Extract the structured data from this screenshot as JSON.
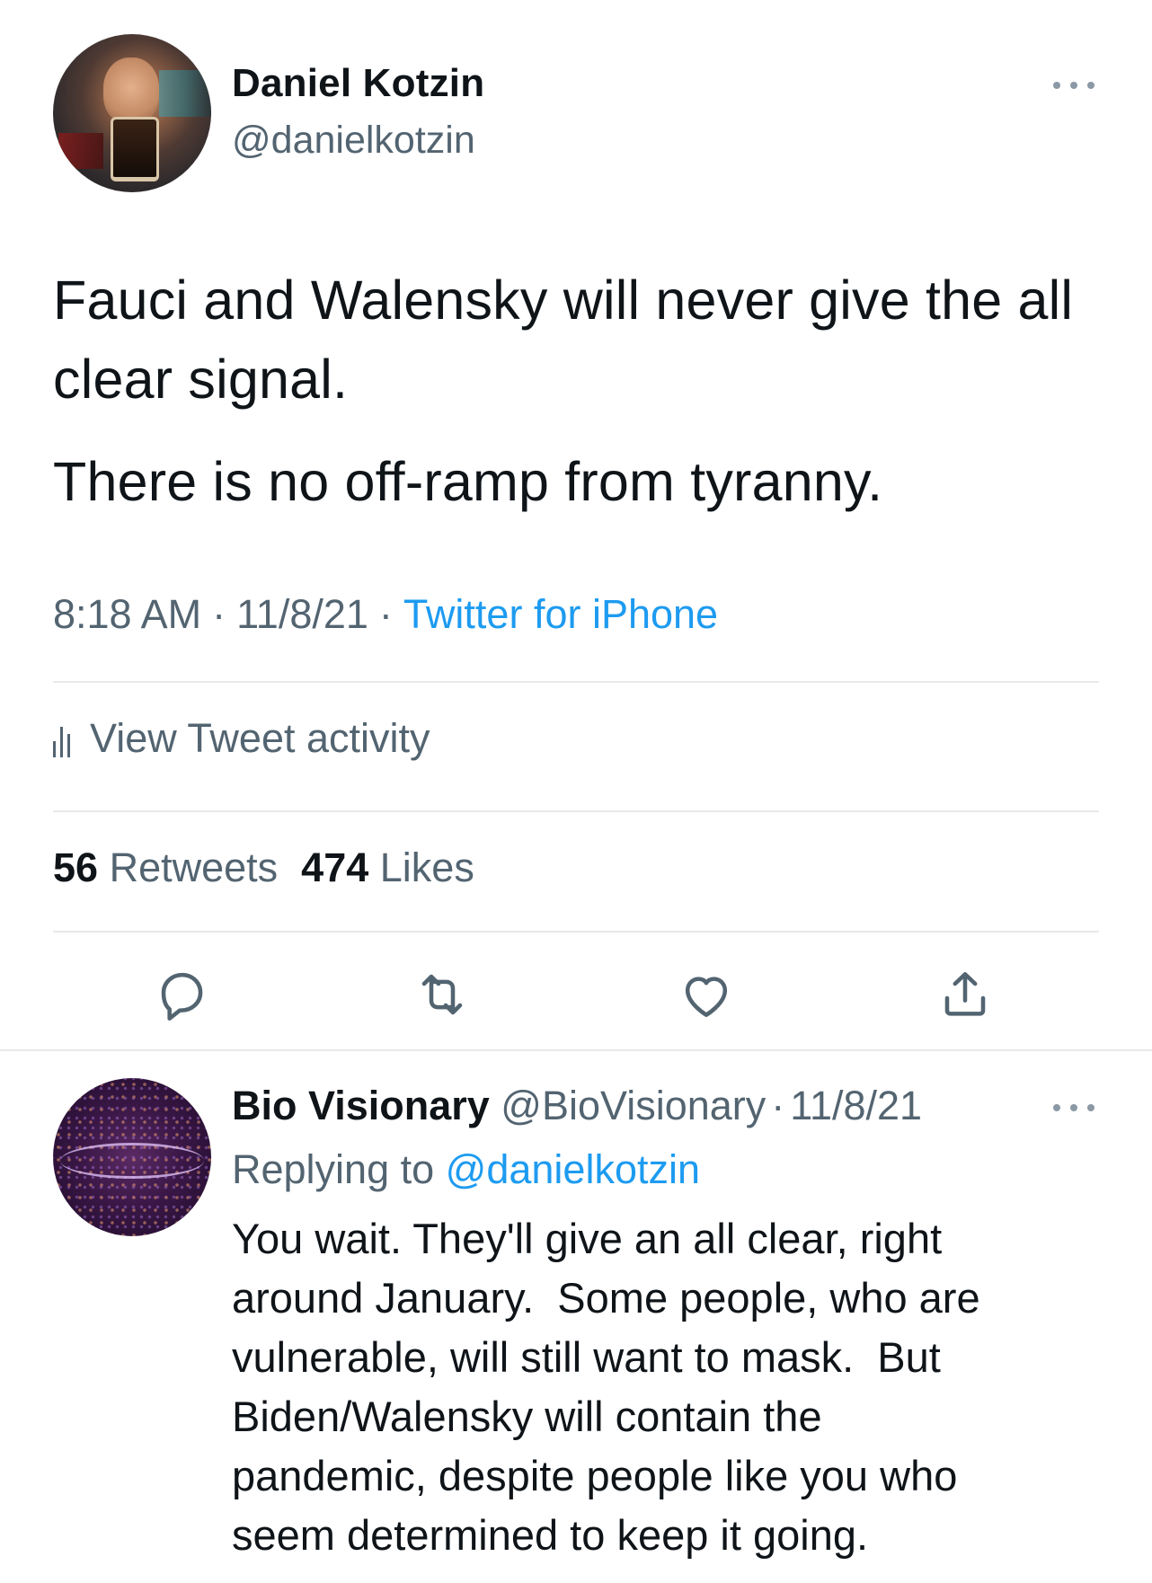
{
  "tweet": {
    "author": {
      "display_name": "Daniel Kotzin",
      "handle": "@danielkotzin"
    },
    "more_icon": "more-horizontal-icon",
    "paragraphs": [
      "Fauci and Walensky will never give the all clear signal.",
      "There is no off-ramp from tyranny."
    ],
    "time": "8:18 AM",
    "date": "11/8/21",
    "separator": "·",
    "source": "Twitter for iPhone",
    "activity_label": "View Tweet activity",
    "activity_icon": "bar-chart-icon",
    "stats": {
      "retweets_count": "56",
      "retweets_label": "Retweets",
      "likes_count": "474",
      "likes_label": "Likes"
    },
    "actions": [
      "reply-icon",
      "retweet-icon",
      "like-icon",
      "share-icon"
    ]
  },
  "reply": {
    "display_name": "Bio Visionary",
    "handle": "@BioVisionary",
    "separator": "·",
    "date": "11/8/21",
    "replying_prefix": "Replying to",
    "replying_to": "@danielkotzin",
    "text_lines": [
      "You wait. They'll give an all clear, right",
      "around January.  Some people, who are",
      "vulnerable, will still want to mask.  But",
      "Biden/Walensky will contain the",
      "pandemic, despite people like you who",
      "seem determined to keep it going."
    ]
  },
  "colors": {
    "text_primary": "#0f1419",
    "text_secondary": "#536471",
    "link": "#1d9bf0",
    "divider": "#e7e9ec"
  }
}
